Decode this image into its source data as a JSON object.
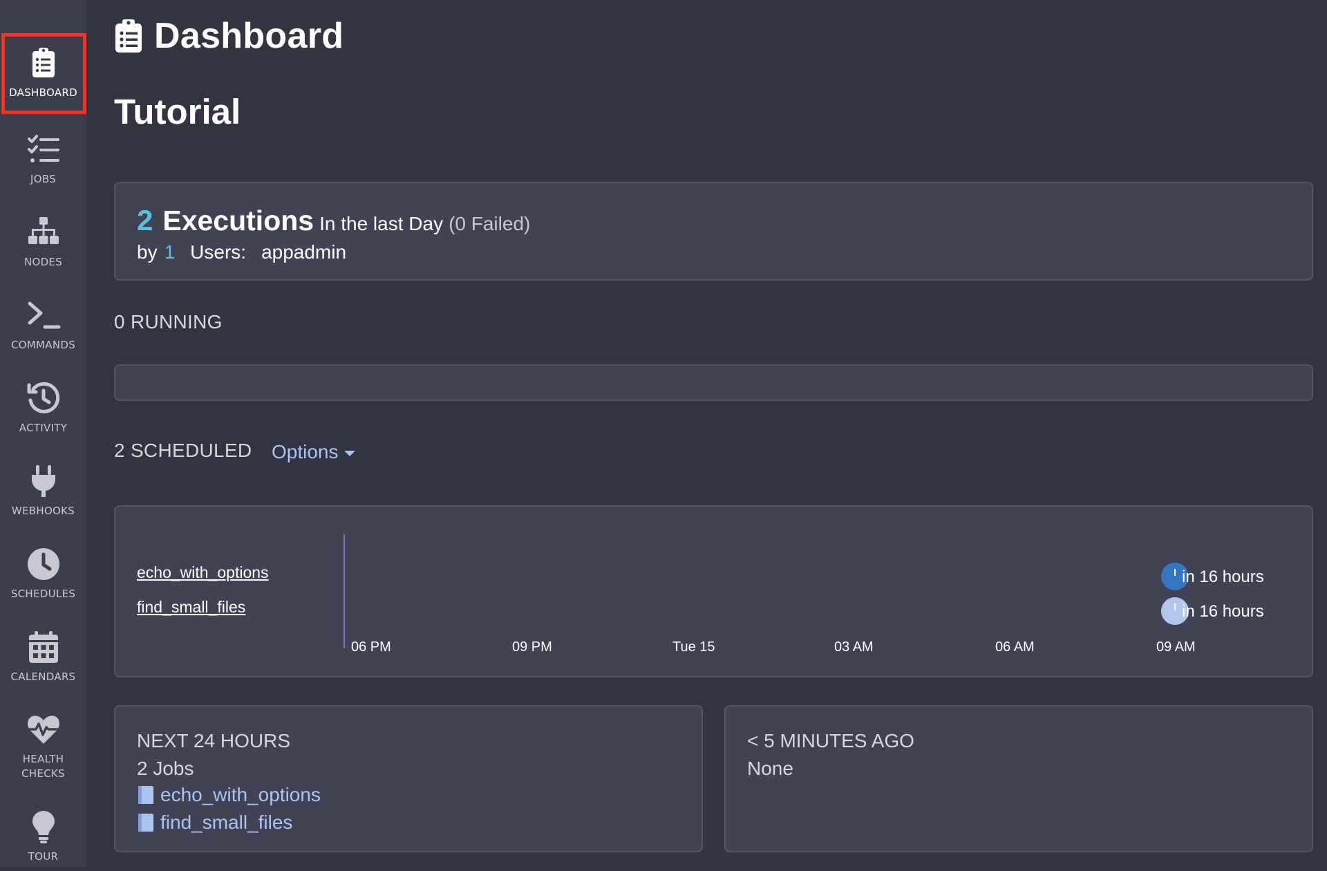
{
  "sidebar": {
    "items": [
      {
        "id": "dashboard",
        "label": "DASHBOARD",
        "icon": "clipboard-list-icon",
        "active": true
      },
      {
        "id": "jobs",
        "label": "JOBS",
        "icon": "tasks-icon",
        "active": false
      },
      {
        "id": "nodes",
        "label": "NODES",
        "icon": "sitemap-icon",
        "active": false
      },
      {
        "id": "commands",
        "label": "COMMANDS",
        "icon": "terminal-icon",
        "active": false
      },
      {
        "id": "activity",
        "label": "ACTIVITY",
        "icon": "history-icon",
        "active": false
      },
      {
        "id": "webhooks",
        "label": "WEBHOOKS",
        "icon": "plug-icon",
        "active": false
      },
      {
        "id": "schedules",
        "label": "SCHEDULES",
        "icon": "clock-icon",
        "active": false
      },
      {
        "id": "calendars",
        "label": "CALENDARS",
        "icon": "calendar-icon",
        "active": false
      },
      {
        "id": "health",
        "label_line1": "HEALTH",
        "label_line2": "CHECKS",
        "icon": "heartbeat-icon",
        "active": false
      },
      {
        "id": "tour",
        "label": "TOUR",
        "icon": "lightbulb-icon",
        "active": false
      }
    ],
    "active_highlight_color": "#e53a2a"
  },
  "header": {
    "title": "Dashboard",
    "icon": "clipboard-list-icon"
  },
  "project": {
    "name": "Tutorial"
  },
  "executions": {
    "count": "2",
    "word": "Executions",
    "period": "In the last Day",
    "failed": "(0 Failed)",
    "by_label": "by",
    "user_count": "1",
    "users_label": "Users:",
    "users": "appadmin"
  },
  "running": {
    "label": "0 RUNNING"
  },
  "scheduled": {
    "label": "2 SCHEDULED",
    "options_label": "Options",
    "jobs": [
      {
        "name": "echo_with_options",
        "next_run": "in 16 hours",
        "marker_color": "#3476c2"
      },
      {
        "name": "find_small_files",
        "next_run": "in 16 hours",
        "marker_color": "#b3c6eb"
      }
    ],
    "ticks": [
      "06 PM",
      "09 PM",
      "Tue 15",
      "03 AM",
      "06 AM",
      "09 AM"
    ]
  },
  "next24": {
    "heading": "NEXT 24 HOURS",
    "summary": "2 Jobs",
    "jobs": [
      {
        "name": "echo_with_options"
      },
      {
        "name": "find_small_files"
      }
    ]
  },
  "recent": {
    "heading": "< 5 MINUTES AGO",
    "summary": "None"
  },
  "colors": {
    "background": "#323441",
    "sidebar": "#3c3e4e",
    "card": "#414354",
    "accent_count": "#5bc0de",
    "link": "#a9c4ee",
    "axis": "#7a73c9"
  }
}
